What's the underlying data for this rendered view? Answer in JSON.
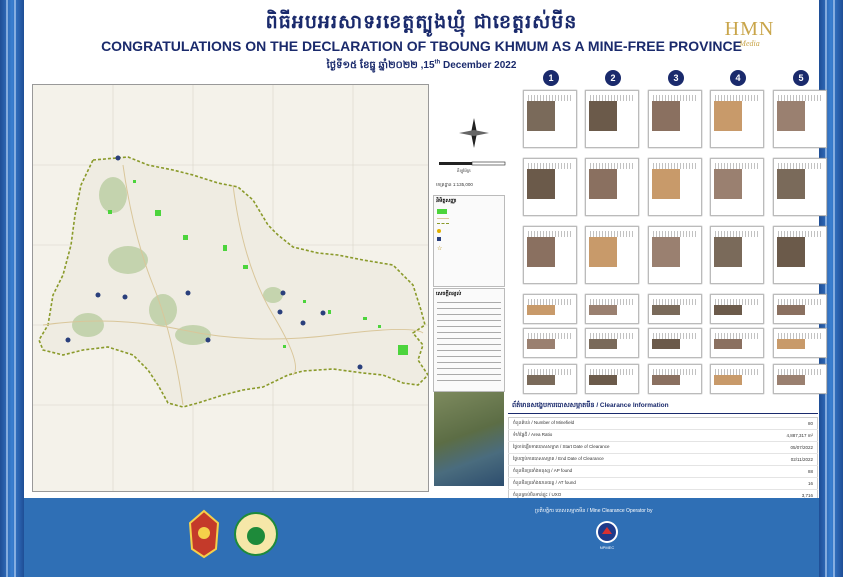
{
  "header": {
    "khmer_title": "ពិធីអបអរសាទរខេត្តត្បូងឃ្មុំ ជាខេត្តរស់មីន",
    "english_title": "CONGRATULATIONS ON THE DECLARATION OF TBOUNG KHMUM AS A MINE-FREE PROVINCE",
    "date_khmer": "ថ្ងៃទី១៥ ខែធ្នូ ឆ្នាំ២០២២ ,",
    "date_day": "15",
    "date_sup": "th",
    "date_rest": " December 2022"
  },
  "brand_logo": {
    "text": "HMN",
    "subtext": "Media",
    "color": "#c9a54a"
  },
  "map": {
    "province_outline_color": "#8a9a2a",
    "cleared_area_color": "#4cd43c",
    "background_color": "#f4f2ea",
    "legend_title": "និមិត្តសញ្ញា",
    "scale_label": "គីឡូម៉ែត្រ",
    "scale_ratio": "មាត្រដ្ឋាន 1:135,000",
    "notes_title": "សេចក្តីពន្យល់"
  },
  "thumbnail_columns": [
    "1",
    "2",
    "3",
    "4",
    "5"
  ],
  "clearance": {
    "title": "ព័ត៌មានសង្ខេបការបោសសម្អាតមីន / Clearance Information",
    "rows": [
      {
        "label": "ចំនួនតំបន់ / Number of Minefield",
        "value": "80"
      },
      {
        "label": "ទំហំផ្ទៃដី / Area Ratio",
        "value": "4,887,317 m²"
      },
      {
        "label": "ថ្ងៃចាប់ផ្តើមការបោសសម្អាត / Start Date of Clearance",
        "value": "05/07/2022"
      },
      {
        "label": "ថ្ងៃបញ្ចប់ការបោសសម្អាត / End Date of Clearance",
        "value": "02/11/2022"
      },
      {
        "label": "ចំនួនមីនប្រឆាំងមនុស្ស / AP found",
        "value": "88"
      },
      {
        "label": "ចំនួនមីនប្រឆាំងយានយន្ត / AT found",
        "value": "16"
      },
      {
        "label": "ចំនួនគ្រាប់មិនទាន់ផ្ទុះ / UXO",
        "value": "3,716"
      }
    ]
  },
  "footer": {
    "operator_label": "ប្រតិបត្តិករ បោសសម្អាតមីន / Mine Clearance Operator by",
    "operator_name": "NPMEC"
  }
}
